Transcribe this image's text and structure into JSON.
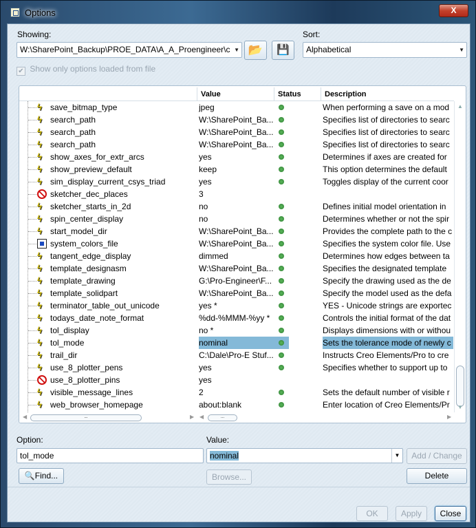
{
  "window": {
    "title": "Options"
  },
  "showing": {
    "label": "Showing:",
    "value": "W:\\SharePoint_Backup\\PROE_DATA\\A_A_Proengineer\\c"
  },
  "sort": {
    "label": "Sort:",
    "value": "Alphabetical"
  },
  "show_only_loaded": {
    "label": "Show only options loaded from file",
    "checked": true,
    "enabled": false
  },
  "table": {
    "columns": [
      "",
      "Value",
      "Status",
      "Description"
    ],
    "rows": [
      {
        "name": "save_bitmap_type",
        "icon": "lightning",
        "value": "jpeg",
        "status": true,
        "description": "When performing a save on a mod"
      },
      {
        "name": "search_path",
        "icon": "lightning",
        "value": "W:\\SharePoint_Ba...",
        "status": true,
        "description": "Specifies list of directories to searc"
      },
      {
        "name": "search_path",
        "icon": "lightning",
        "value": "W:\\SharePoint_Ba...",
        "status": true,
        "description": "Specifies list of directories to searc"
      },
      {
        "name": "search_path",
        "icon": "lightning",
        "value": "W:\\SharePoint_Ba...",
        "status": true,
        "description": "Specifies list of directories to searc"
      },
      {
        "name": "show_axes_for_extr_arcs",
        "icon": "lightning",
        "value": "yes",
        "status": true,
        "description": "Determines if axes are created for"
      },
      {
        "name": "show_preview_default",
        "icon": "lightning",
        "value": "keep",
        "status": true,
        "description": "This option determines the default"
      },
      {
        "name": "sim_display_current_csys_triad",
        "icon": "lightning",
        "value": "yes",
        "status": true,
        "description": "Toggles display of the current coor"
      },
      {
        "name": "sketcher_dec_places",
        "icon": "prohibited",
        "value": "3",
        "status": false,
        "description": ""
      },
      {
        "name": "sketcher_starts_in_2d",
        "icon": "lightning",
        "value": "no",
        "status": true,
        "description": "Defines initial model orientation in"
      },
      {
        "name": "spin_center_display",
        "icon": "lightning",
        "value": "no",
        "status": true,
        "description": "Determines whether or not the spir"
      },
      {
        "name": "start_model_dir",
        "icon": "lightning",
        "value": "W:\\SharePoint_Ba...",
        "status": true,
        "description": "Provides the complete path to the c"
      },
      {
        "name": "system_colors_file",
        "icon": "system-colors",
        "value": "W:\\SharePoint_Ba...",
        "status": true,
        "description": "Specifies the system color file. Use"
      },
      {
        "name": "tangent_edge_display",
        "icon": "lightning",
        "value": "dimmed",
        "status": true,
        "description": "Determines how edges between ta"
      },
      {
        "name": "template_designasm",
        "icon": "lightning",
        "value": "W:\\SharePoint_Ba...",
        "status": true,
        "description": "Specifies the designated template"
      },
      {
        "name": "template_drawing",
        "icon": "lightning",
        "value": "G:\\Pro-Engineer\\F...",
        "status": true,
        "description": "Specify the drawing used as the de"
      },
      {
        "name": "template_solidpart",
        "icon": "lightning",
        "value": "W:\\SharePoint_Ba...",
        "status": true,
        "description": "Specify the model used as the defa"
      },
      {
        "name": "terminator_table_out_unicode",
        "icon": "lightning",
        "value": "yes *",
        "status": true,
        "description": "YES - Unicode strings are exportec"
      },
      {
        "name": "todays_date_note_format",
        "icon": "lightning",
        "value": "%dd-%MMM-%yy *",
        "status": true,
        "description": "Controls the initial format of the dat"
      },
      {
        "name": "tol_display",
        "icon": "lightning",
        "value": "no *",
        "status": true,
        "description": "Displays dimensions with or withou"
      },
      {
        "name": "tol_mode",
        "icon": "lightning",
        "value": "nominal",
        "status": true,
        "description": "Sets the tolerance mode of newly c",
        "selected": true
      },
      {
        "name": "trail_dir",
        "icon": "lightning",
        "value": "C:\\Dale\\Pro-E Stuf...",
        "status": true,
        "description": "Instructs Creo Elements/Pro to cre"
      },
      {
        "name": "use_8_plotter_pens",
        "icon": "lightning",
        "value": "yes",
        "status": true,
        "description": "Specifies whether to support up to"
      },
      {
        "name": "use_8_plotter_pins",
        "icon": "prohibited",
        "value": "yes",
        "status": false,
        "description": ""
      },
      {
        "name": "visible_message_lines",
        "icon": "lightning",
        "value": "2",
        "status": true,
        "description": "Sets the default number of visible r"
      },
      {
        "name": "web_browser_homepage",
        "icon": "lightning",
        "value": "about:blank",
        "status": true,
        "description": "Enter location of Creo Elements/Pr"
      }
    ]
  },
  "option": {
    "label": "Option:",
    "value": "tol_mode"
  },
  "value": {
    "label": "Value:",
    "value": "nominal"
  },
  "buttons": {
    "add_change": "Add / Change",
    "find": "Find...",
    "browse": "Browse...",
    "delete": "Delete",
    "ok": "OK",
    "apply": "Apply",
    "close": "Close"
  },
  "colors": {
    "selection": "#84b9d8",
    "status_ok": "#2e7d32"
  }
}
